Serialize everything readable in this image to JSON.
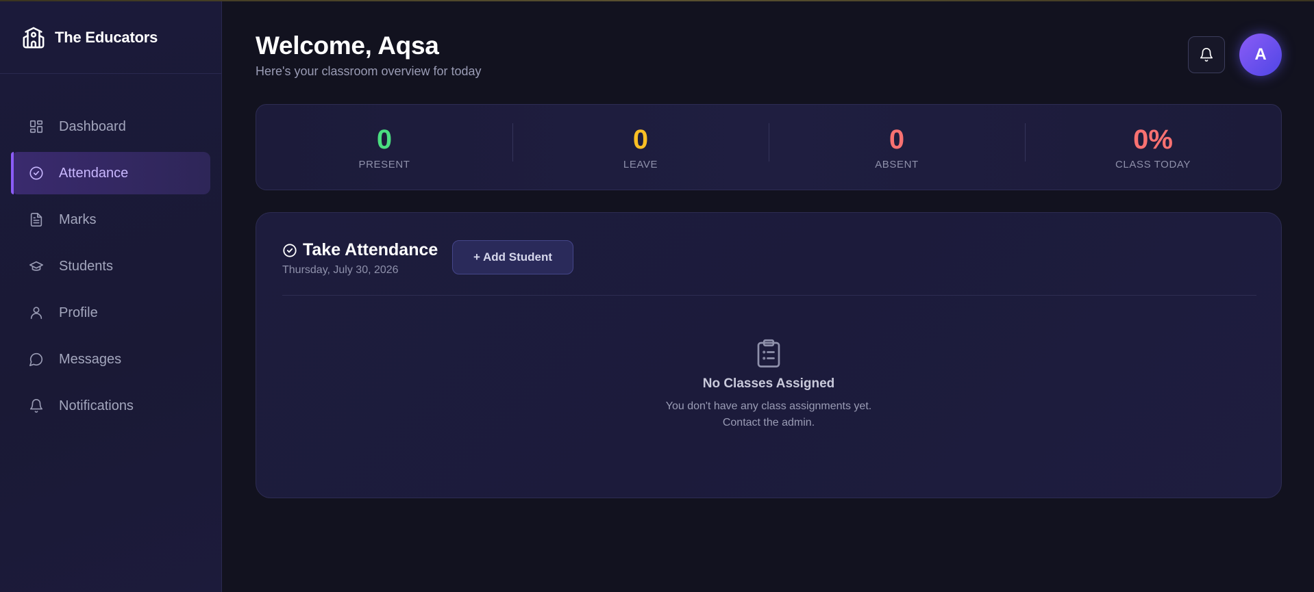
{
  "sidebar": {
    "brand": "The Educators",
    "items": [
      {
        "label": "Dashboard",
        "icon": "dashboard-icon"
      },
      {
        "label": "Attendance",
        "icon": "check-circle-icon",
        "active": true
      },
      {
        "label": "Marks",
        "icon": "document-icon"
      },
      {
        "label": "Students",
        "icon": "graduation-cap-icon"
      },
      {
        "label": "Profile",
        "icon": "user-icon"
      },
      {
        "label": "Messages",
        "icon": "message-bubble-icon"
      },
      {
        "label": "Notifications",
        "icon": "bell-icon"
      }
    ]
  },
  "header": {
    "title": "Welcome, Aqsa",
    "subtitle": "Here's your classroom overview for today",
    "avatar_initial": "A"
  },
  "stats": [
    {
      "value": "0",
      "label": "PRESENT",
      "color": "#4ade80"
    },
    {
      "value": "0",
      "label": "LEAVE",
      "color": "#fbbf24"
    },
    {
      "value": "0",
      "label": "ABSENT",
      "color": "#f87171"
    },
    {
      "value": "0%",
      "label": "CLASS TODAY",
      "color": "#f87171"
    }
  ],
  "attendance": {
    "title": "Take Attendance",
    "date": "Thursday, July 30, 2026",
    "add_button": "+ Add Student",
    "empty_title": "No Classes Assigned",
    "empty_line1": "You don't have any class assignments yet.",
    "empty_line2": "Contact the admin."
  },
  "colors": {
    "accent": "#8b5cf6",
    "background": "#12121f",
    "sidebar": "#1b1a3a"
  }
}
